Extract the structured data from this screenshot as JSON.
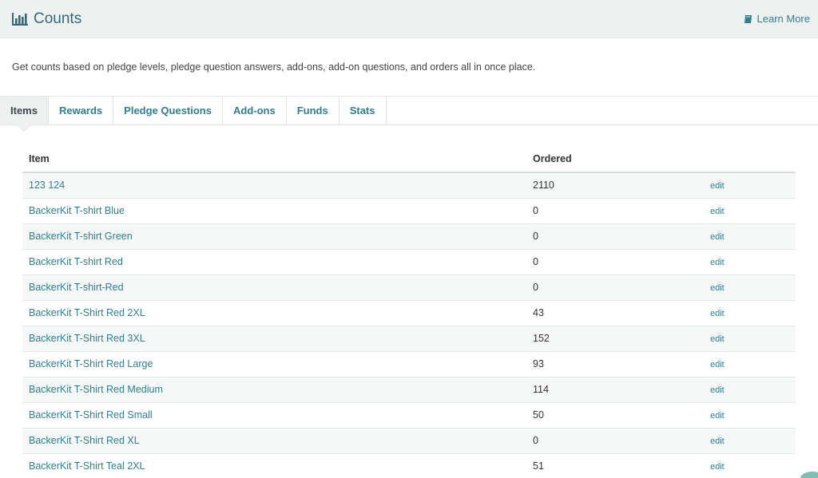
{
  "header": {
    "title": "Counts",
    "title_icon": "bar-chart-icon",
    "learn_more": "Learn More",
    "learn_icon": "book-icon"
  },
  "description": "Get counts based on pledge levels, pledge question answers, add-ons, add-on questions, and orders all in once place.",
  "tabs": [
    {
      "label": "Items",
      "active": true
    },
    {
      "label": "Rewards",
      "active": false
    },
    {
      "label": "Pledge Questions",
      "active": false
    },
    {
      "label": "Add-ons",
      "active": false
    },
    {
      "label": "Funds",
      "active": false
    },
    {
      "label": "Stats",
      "active": false
    }
  ],
  "table": {
    "headers": {
      "item": "Item",
      "ordered": "Ordered"
    },
    "edit_label": "edit",
    "rows": [
      {
        "item": "123 124",
        "ordered": "2110"
      },
      {
        "item": "BackerKit T-shirt Blue",
        "ordered": "0"
      },
      {
        "item": "BackerKit T-shirt Green",
        "ordered": "0"
      },
      {
        "item": "BackerKit T-shirt Red",
        "ordered": "0"
      },
      {
        "item": "BackerKit T-shirt-Red",
        "ordered": "0"
      },
      {
        "item": "BackerKit T-Shirt Red 2XL",
        "ordered": "43"
      },
      {
        "item": "BackerKit T-Shirt Red 3XL",
        "ordered": "152"
      },
      {
        "item": "BackerKit T-Shirt Red Large",
        "ordered": "93"
      },
      {
        "item": "BackerKit T-Shirt Red Medium",
        "ordered": "114"
      },
      {
        "item": "BackerKit T-Shirt Red Small",
        "ordered": "50"
      },
      {
        "item": "BackerKit T-Shirt Red XL",
        "ordered": "0"
      },
      {
        "item": "BackerKit T-Shirt Teal 2XL",
        "ordered": "51"
      }
    ]
  },
  "colors": {
    "accent": "#2f7f8f",
    "title": "#2f6b7c",
    "header_bg": "#eef1ef"
  }
}
